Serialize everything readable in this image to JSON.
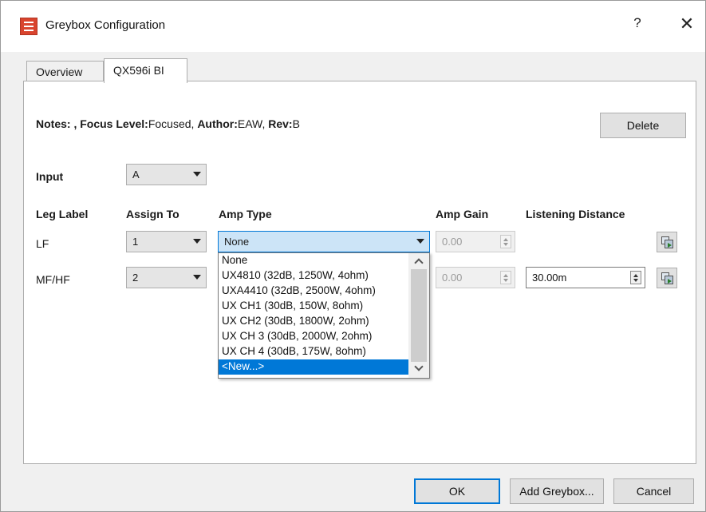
{
  "window": {
    "title": "Greybox Configuration",
    "help_label": "?",
    "close_label": "✕"
  },
  "tabs": [
    {
      "label": "Overview",
      "active": false
    },
    {
      "label": "QX596i BI",
      "active": true
    }
  ],
  "notes": {
    "notes_label": "Notes:",
    "notes_value": ",",
    "focus_label": "Focus Level:",
    "focus_value": "Focused,",
    "author_label": "Author:",
    "author_value": "EAW,",
    "rev_label": "Rev:",
    "rev_value": "B"
  },
  "delete_button": "Delete",
  "input": {
    "label": "Input",
    "value": "A"
  },
  "columns": {
    "leg_label": "Leg Label",
    "assign_to": "Assign To",
    "amp_type": "Amp Type",
    "amp_gain": "Amp Gain",
    "listening_distance": "Listening Distance"
  },
  "rows": [
    {
      "leg": "LF",
      "assign": "1",
      "amp_type": "None",
      "gain": "0.00",
      "distance": ""
    },
    {
      "leg": "MF/HF",
      "assign": "2",
      "amp_type": "",
      "gain": "0.00",
      "distance": "30.00m"
    }
  ],
  "amp_type_options": [
    "None",
    "UX4810 (32dB, 1250W, 4ohm)",
    "UXA4410 (32dB, 2500W, 4ohm)",
    "UX CH1 (30dB, 150W, 8ohm)",
    "UX CH2 (30dB, 1800W, 2ohm)",
    "UX CH 3 (30dB, 2000W, 2ohm)",
    "UX CH 4 (30dB, 175W, 8ohm)",
    "<New...>"
  ],
  "selected_option": "<New...>",
  "footer": {
    "ok": "OK",
    "add_greybox": "Add Greybox...",
    "cancel": "Cancel"
  },
  "icons": {
    "app": "greybox-app-icon",
    "row_action": "copy-settings-icon"
  },
  "colors": {
    "accent": "#0078d7",
    "app_icon": "#d9442e"
  }
}
